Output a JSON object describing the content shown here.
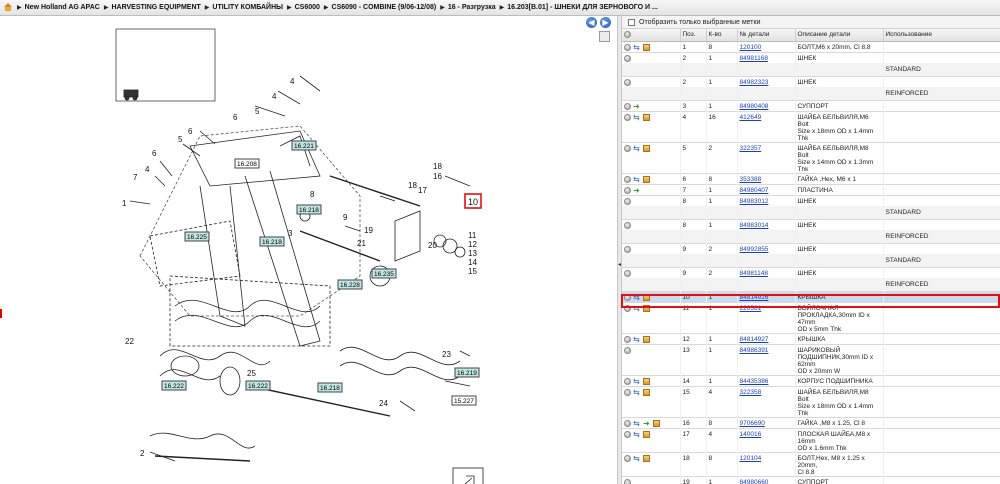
{
  "breadcrumb": {
    "items": [
      "New Holland AG APAC",
      "HARVESTING EQUIPMENT",
      "UTILITY КОМБАЙНЫ",
      "CS6000",
      "CS6090 - COMBINE (9/06-12/08)",
      "16 - Разгрузка",
      "16.203[B.01] - ШНЕКИ ДЛЯ ЗЕРНОВОГО И ..."
    ]
  },
  "filter": {
    "label": "Отобразить только выбранные метки"
  },
  "columns": {
    "pos": "Поз.",
    "qty": "К-во",
    "part_no": "№ детали",
    "desc": "Описание детали",
    "usage": "Использование"
  },
  "rows": [
    {
      "pos": "1",
      "qty": "8",
      "part": "120100",
      "desc": [
        "БОЛТ,M6 x 20mm, Cl 8.8"
      ],
      "icons": [
        "grey",
        "blue",
        "box"
      ],
      "usage": ""
    },
    {
      "pos": "2",
      "qty": "1",
      "part": "84981168",
      "desc": [
        "ШНЕК"
      ],
      "icons": [
        "grey"
      ],
      "usage": "STANDARD"
    },
    {
      "pos": "2",
      "qty": "1",
      "part": "84982323",
      "desc": [
        "ШНЕК"
      ],
      "icons": [
        "grey"
      ],
      "usage": "REINFORCED"
    },
    {
      "pos": "3",
      "qty": "1",
      "part": "84980408",
      "desc": [
        "СУППОРТ"
      ],
      "icons": [
        "grey",
        "green"
      ],
      "usage": ""
    },
    {
      "pos": "4",
      "qty": "16",
      "part": "412649",
      "desc": [
        "ШАЙБА БЕЛЬВИЛЯ,M6 Bolt",
        "Size x 18mm OD x 1.4mm Thk"
      ],
      "icons": [
        "grey",
        "blue",
        "box"
      ],
      "usage": ""
    },
    {
      "pos": "5",
      "qty": "2",
      "part": "322357",
      "desc": [
        "ШАЙБА БЕЛЬВИЛЯ,M8 Bolt",
        "Size x 14mm OD x 1.3mm Thk"
      ],
      "icons": [
        "grey",
        "blue",
        "box"
      ],
      "usage": ""
    },
    {
      "pos": "6",
      "qty": "8",
      "part": "353388",
      "desc": [
        "ГАЙКА ,Hex, M6 x 1"
      ],
      "icons": [
        "grey",
        "blue",
        "box"
      ],
      "usage": ""
    },
    {
      "pos": "7",
      "qty": "1",
      "part": "84980407",
      "desc": [
        "ПЛАСТИНА"
      ],
      "icons": [
        "grey",
        "green"
      ],
      "usage": ""
    },
    {
      "pos": "8",
      "qty": "1",
      "part": "84983012",
      "desc": [
        "ШНЕК"
      ],
      "icons": [
        "grey"
      ],
      "usage": "STANDARD"
    },
    {
      "pos": "8",
      "qty": "1",
      "part": "84983014",
      "desc": [
        "ШНЕК"
      ],
      "icons": [
        "grey"
      ],
      "usage": "REINFORCED"
    },
    {
      "pos": "9",
      "qty": "2",
      "part": "84992855",
      "desc": [
        "ШНЕК"
      ],
      "icons": [
        "grey"
      ],
      "usage": "STANDARD"
    },
    {
      "pos": "9",
      "qty": "2",
      "part": "84981148",
      "desc": [
        "ШНЕК"
      ],
      "icons": [
        "grey"
      ],
      "usage": "REINFORCED"
    },
    {
      "pos": "10",
      "qty": "1",
      "part": "84814926",
      "desc": [
        "КРЫШКА"
      ],
      "icons": [
        "grey",
        "blue",
        "box"
      ],
      "usage": "",
      "selected": true
    },
    {
      "pos": "11",
      "qty": "1",
      "part": "220561",
      "desc": [
        "ВОЙЛОЧНАЯ",
        "ПРОКЛАДКА,30mm ID x 47mm",
        "OD x 5mm Thk"
      ],
      "icons": [
        "grey",
        "blue",
        "box"
      ],
      "usage": ""
    },
    {
      "pos": "12",
      "qty": "1",
      "part": "84814927",
      "desc": [
        "КРЫШКА"
      ],
      "icons": [
        "grey",
        "blue",
        "box"
      ],
      "usage": ""
    },
    {
      "pos": "13",
      "qty": "1",
      "part": "84986391",
      "desc": [
        "ШАРИКОВЫЙ",
        "ПОДШИПНИК,30mm ID x 62mm",
        "OD x 20mm W"
      ],
      "icons": [
        "grey"
      ],
      "usage": ""
    },
    {
      "pos": "14",
      "qty": "1",
      "part": "84435386",
      "desc": [
        "КОРПУС ПОДШИПНИКА"
      ],
      "icons": [
        "grey",
        "blue",
        "box"
      ],
      "usage": ""
    },
    {
      "pos": "15",
      "qty": "4",
      "part": "322358",
      "desc": [
        "ШАЙБА БЕЛЬВИЛЯ,M8 Bolt",
        "Size x 18mm OD x 1.4mm Thk"
      ],
      "icons": [
        "grey",
        "blue",
        "box"
      ],
      "usage": ""
    },
    {
      "pos": "16",
      "qty": "8",
      "part": "9706690",
      "desc": [
        "ГАЙКА ,M8 x 1.25, Cl 8"
      ],
      "icons": [
        "grey",
        "blue",
        "green",
        "box"
      ],
      "usage": ""
    },
    {
      "pos": "17",
      "qty": "4",
      "part": "140016",
      "desc": [
        "ПЛОСКАЯ ШАЙБА,M8 x 16mm",
        "OD x 1.6mm Thk"
      ],
      "icons": [
        "grey",
        "blue",
        "box"
      ],
      "usage": ""
    },
    {
      "pos": "18",
      "qty": "8",
      "part": "120104",
      "desc": [
        "БОЛТ,Hex, M8 x 1.25 x 20mm,",
        "Cl 8.8"
      ],
      "icons": [
        "grey",
        "blue",
        "box"
      ],
      "usage": ""
    },
    {
      "pos": "19",
      "qty": "1",
      "part": "84980660",
      "desc": [
        "СУППОРТ"
      ],
      "icons": [
        "grey"
      ],
      "usage": ""
    }
  ],
  "diagram": {
    "labels": [
      "1",
      "2",
      "3",
      "4",
      "4",
      "4",
      "5",
      "5",
      "6",
      "6",
      "7",
      "8",
      "9",
      "10",
      "11",
      "12",
      "13",
      "14",
      "15",
      "16",
      "17",
      "18",
      "18",
      "19",
      "20",
      "21",
      "22",
      "23",
      "24",
      "25"
    ],
    "refs": [
      "16.208",
      "16.221",
      "16.218",
      "16.225",
      "16.218",
      "16.235",
      "16.228",
      "16.219",
      "16.222",
      "16.222",
      "16.218",
      "16.219",
      "15.227"
    ]
  }
}
